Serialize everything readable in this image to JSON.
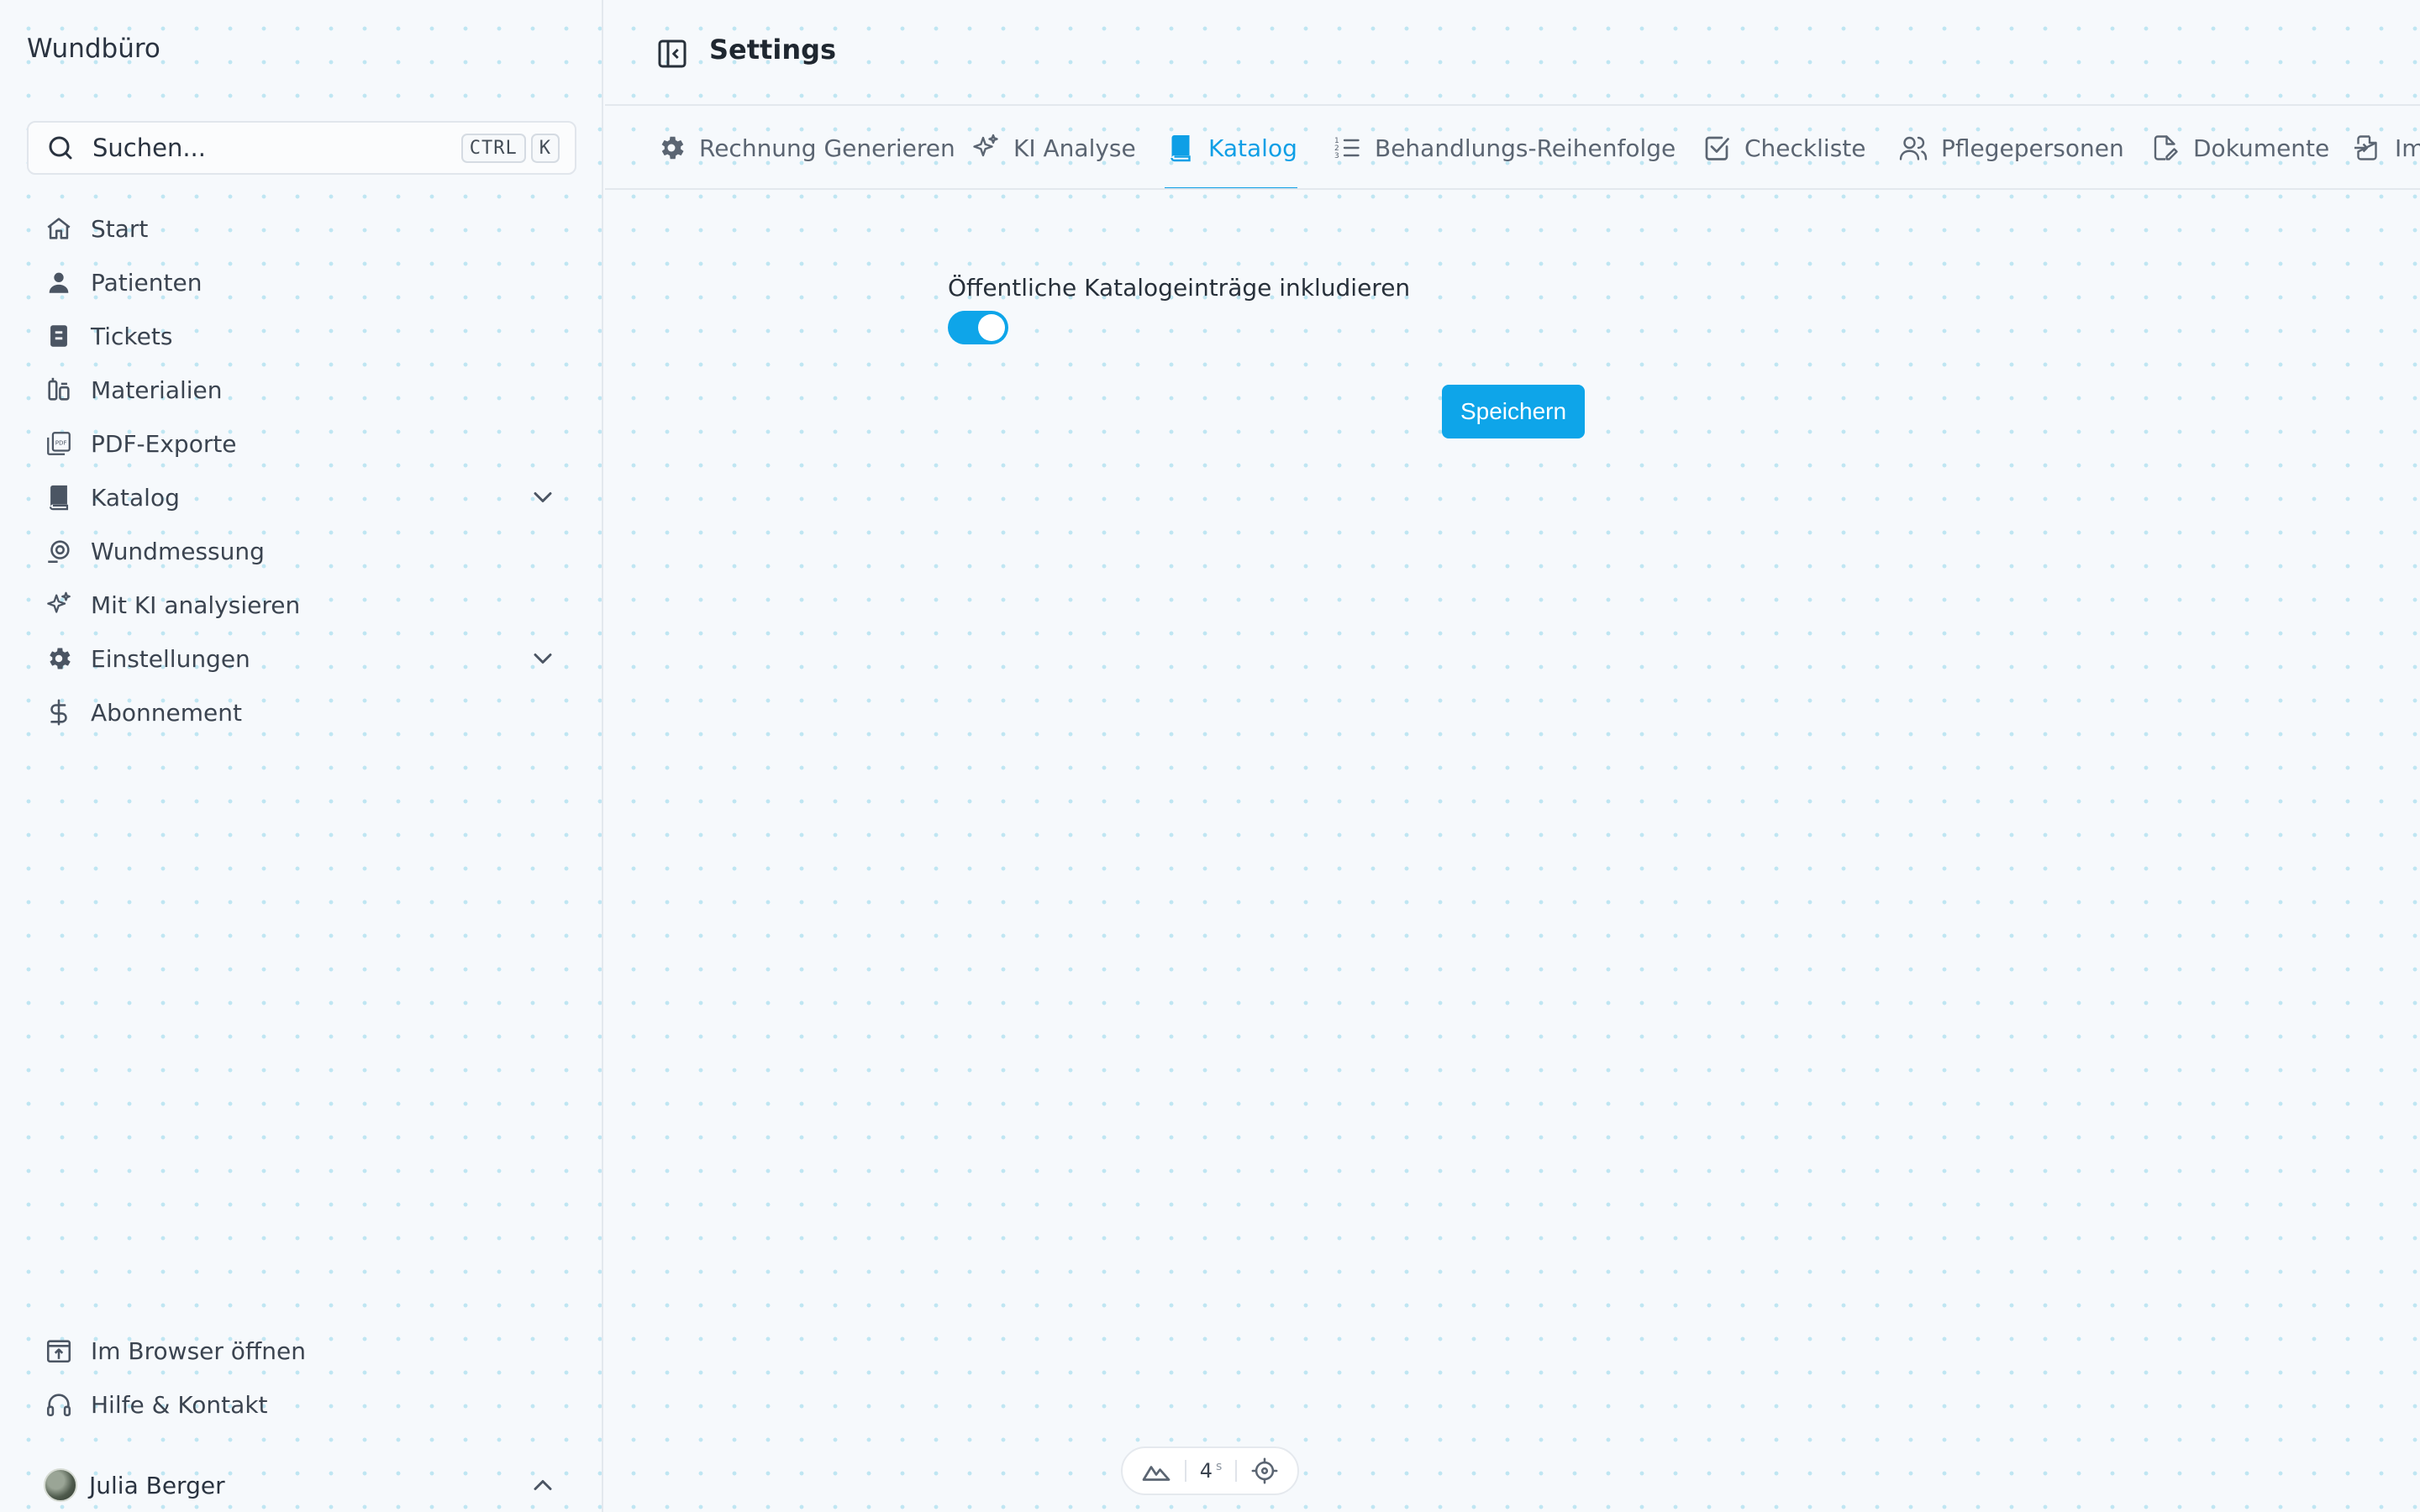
{
  "app": {
    "brand": "Wundbüro"
  },
  "search": {
    "placeholder": "Suchen...",
    "shortcut_ctrl": "CTRL",
    "shortcut_key": "K"
  },
  "sidebar": {
    "items": [
      {
        "label": "Start",
        "icon": "home-icon"
      },
      {
        "label": "Patienten",
        "icon": "user-icon"
      },
      {
        "label": "Tickets",
        "icon": "ticket-icon"
      },
      {
        "label": "Materialien",
        "icon": "materials-icon"
      },
      {
        "label": "PDF-Exporte",
        "icon": "pdf-icon"
      },
      {
        "label": "Katalog",
        "icon": "book-icon",
        "expandable": true
      },
      {
        "label": "Wundmessung",
        "icon": "measure-icon"
      },
      {
        "label": "Mit KI analysieren",
        "icon": "sparkle-icon"
      },
      {
        "label": "Einstellungen",
        "icon": "gear-icon",
        "expandable": true
      },
      {
        "label": "Abonnement",
        "icon": "dollar-icon"
      }
    ],
    "bottom_items": [
      {
        "label": "Im Browser öffnen",
        "icon": "browser-open-icon"
      },
      {
        "label": "Hilfe & Kontakt",
        "icon": "headset-icon"
      }
    ],
    "user": {
      "name": "Julia Berger"
    }
  },
  "header": {
    "title": "Settings"
  },
  "tabs": [
    {
      "label": "Rechnung Generieren",
      "icon": "gear-icon"
    },
    {
      "label": "KI Analyse",
      "icon": "sparkle-icon"
    },
    {
      "label": "Katalog",
      "icon": "book-icon",
      "active": true
    },
    {
      "label": "Behandlungs-Reihenfolge",
      "icon": "list-ordered-icon"
    },
    {
      "label": "Checkliste",
      "icon": "checkbox-icon"
    },
    {
      "label": "Pflegepersonen",
      "icon": "users-icon"
    },
    {
      "label": "Dokumente",
      "icon": "document-edit-icon"
    },
    {
      "label": "Im",
      "icon": "import-icon"
    }
  ],
  "form": {
    "toggle_label": "Öffentliche Katalogeinträge inkludieren",
    "toggle_on": true,
    "save_label": "Speichern"
  },
  "devtools": {
    "value": "4",
    "unit": "s"
  },
  "colors": {
    "accent": "#0ea5e9",
    "text": "#27303a",
    "muted": "#5b6572",
    "border": "#e3e8ee"
  }
}
